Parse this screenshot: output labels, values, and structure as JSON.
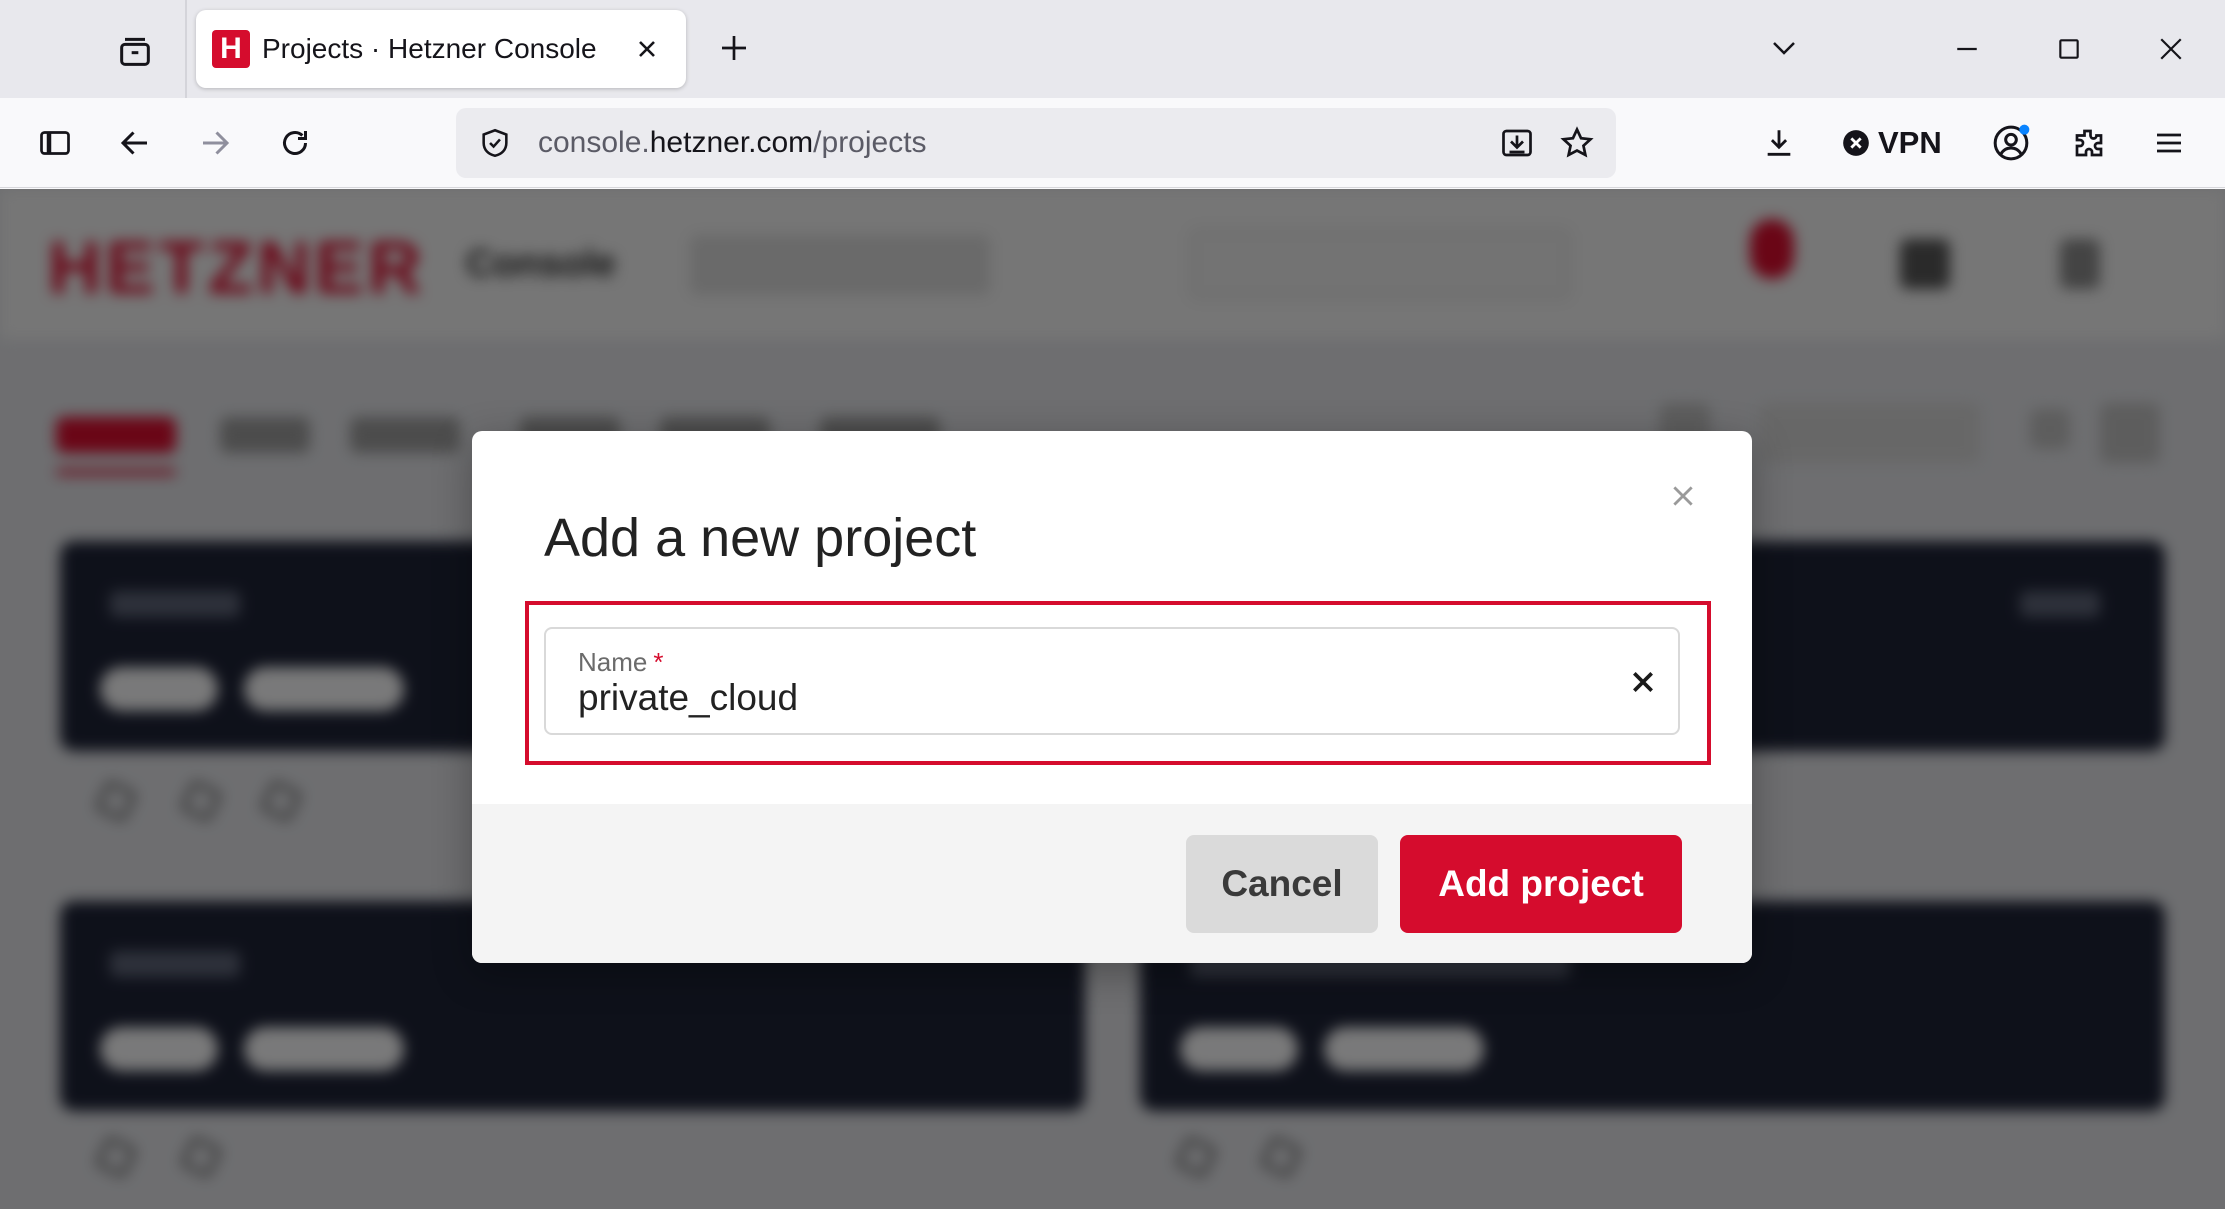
{
  "browser": {
    "tab": {
      "title": "Projects · Hetzner Console",
      "favicon_letter": "H",
      "favicon_color": "#d50c2d"
    },
    "url": {
      "host": "console.hetzner.com",
      "prefix": "console.",
      "domain": "hetzner.com",
      "path": "/projects"
    },
    "toolbar": {
      "vpn_label": "VPN"
    },
    "icons": [
      "tab-manager-icon",
      "new-tab-icon",
      "tab-list-icon",
      "minimize-icon",
      "maximize-icon",
      "window-close-icon",
      "sidebar-icon",
      "back-icon",
      "forward-icon",
      "reload-icon",
      "shield-icon",
      "page-save-icon",
      "bookmark-star-icon",
      "downloads-icon",
      "vpn-off-icon",
      "account-icon",
      "extensions-icon",
      "menu-icon"
    ]
  },
  "background_app": {
    "logo": "HETZNER",
    "header_label": "Console"
  },
  "modal": {
    "title": "Add a new project",
    "field": {
      "label": "Name",
      "required_mark": "*",
      "value": "private_cloud"
    },
    "cancel_label": "Cancel",
    "submit_label": "Add project",
    "accent_color": "#d50c2d"
  }
}
